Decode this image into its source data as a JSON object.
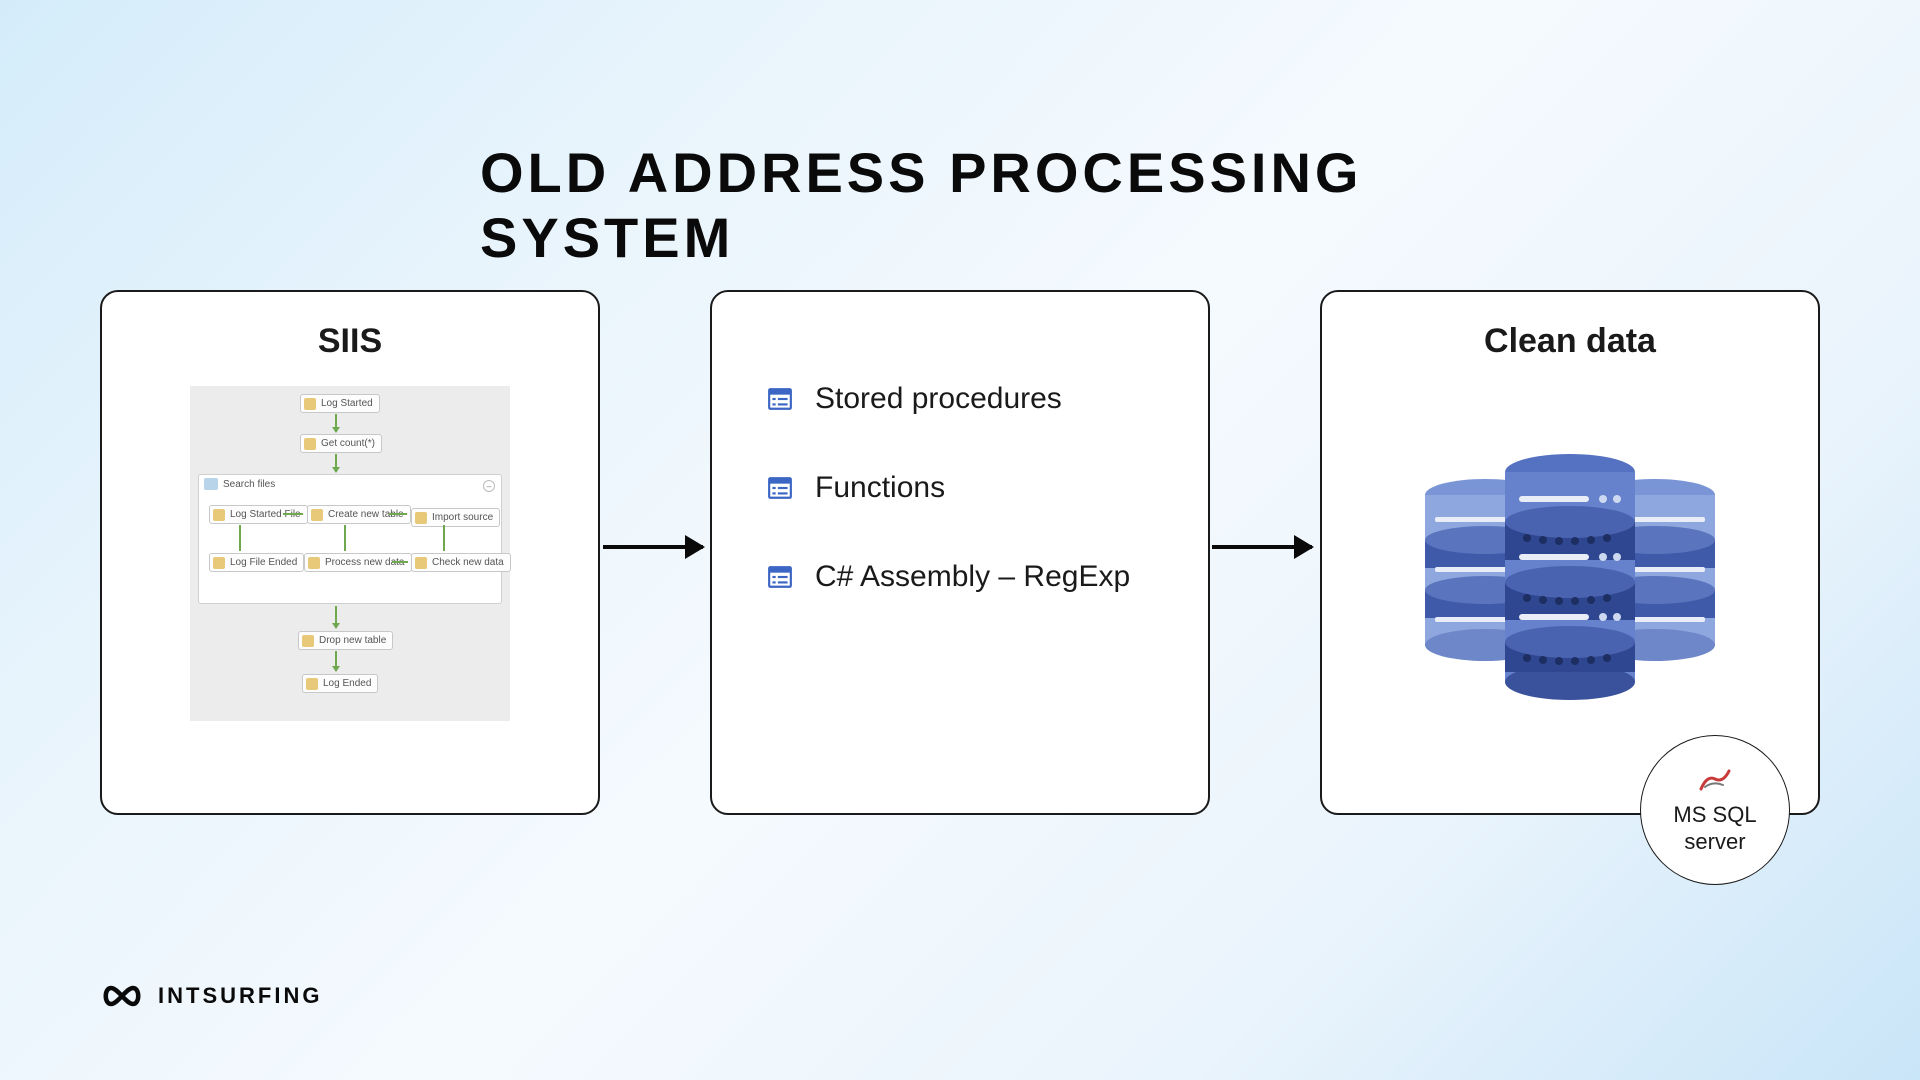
{
  "title": "OLD ADDRESS PROCESSING SYSTEM",
  "panel1": {
    "title": "SIIS",
    "nodes": {
      "n1": "Log Started",
      "n2": "Get count(*)",
      "group": "Search files",
      "g1": "Log Started File",
      "g2": "Create new table",
      "g3": "Import source",
      "g4": "Log File Ended",
      "g5": "Process new data",
      "g6": "Check new data",
      "n3": "Drop new table",
      "n4": "Log Ended"
    }
  },
  "panel2": {
    "items": [
      "Stored procedures",
      "Functions",
      "C# Assembly – RegExp"
    ]
  },
  "panel3": {
    "title": "Clean data"
  },
  "badge": {
    "line1": "MS SQL",
    "line2": "server"
  },
  "brand": "INTSURFING"
}
